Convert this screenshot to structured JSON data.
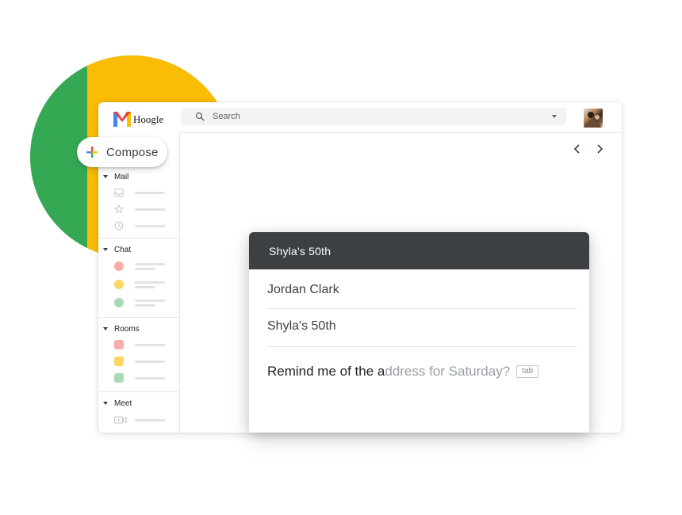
{
  "brand": {
    "name": "Hoogle"
  },
  "search": {
    "placeholder": "Search"
  },
  "compose": {
    "label": "Compose"
  },
  "sidebar": {
    "sections": [
      {
        "label": "Mail"
      },
      {
        "label": "Chat"
      },
      {
        "label": "Rooms"
      },
      {
        "label": "Meet"
      }
    ]
  },
  "card": {
    "title": "Shyla's 50th",
    "recipient": "Jordan Clark",
    "subject": "Shyla's 50th",
    "body_typed": "Remind me of the a",
    "body_suggestion": "ddress for Saturday?",
    "tab_hint": "tab"
  },
  "colors": {
    "green": "#34a853",
    "yellow": "#fbbc04",
    "red": "#ea4335",
    "blue": "#4285f4",
    "header_dark": "#3c4043"
  },
  "icons": [
    "search-icon",
    "dropdown-caret-icon",
    "inbox-icon",
    "star-icon",
    "clock-icon",
    "video-icon",
    "chevron-left-icon",
    "chevron-right-icon",
    "plus-icon"
  ]
}
